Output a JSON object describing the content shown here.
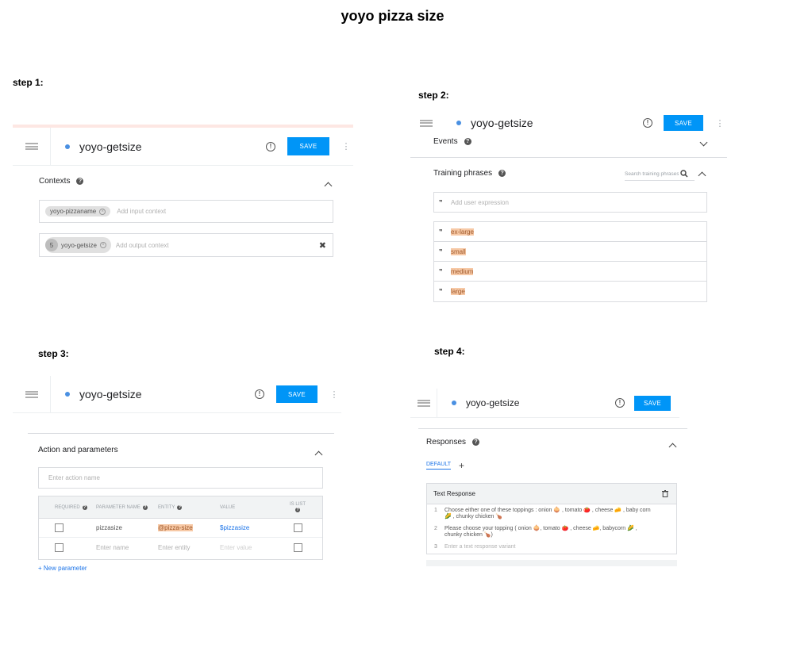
{
  "page_title": "yoyo pizza size",
  "steps": [
    "step 1:",
    "step 2:",
    "step 3:",
    "step 4:"
  ],
  "intent_name": "yoyo-getsize",
  "save_label": "SAVE",
  "step1": {
    "contexts_label": "Contexts",
    "input_chip": "yoyo-pizzaname",
    "input_placeholder": "Add input context",
    "output_lifespan": "5",
    "output_chip": "yoyo-getsize",
    "output_placeholder": "Add output context"
  },
  "step2": {
    "events_label": "Events",
    "training_label": "Training phrases",
    "search_placeholder": "Search training phrases",
    "add_expression_placeholder": "Add user expression",
    "phrases": [
      "ex-large",
      "small",
      "medium",
      "large"
    ]
  },
  "step3": {
    "section_label": "Action and parameters",
    "action_placeholder": "Enter action name",
    "columns": {
      "required": "REQUIRED",
      "param_name": "PARAMETER NAME",
      "entity": "ENTITY",
      "value": "VALUE",
      "is_list": "IS LIST"
    },
    "row1": {
      "name": "pizzasize",
      "entity": "@pizza-size",
      "value": "$pizzasize"
    },
    "row2": {
      "name": "Enter name",
      "entity": "Enter entity",
      "value": "Enter value"
    },
    "new_param": "+ New parameter"
  },
  "step4": {
    "responses_label": "Responses",
    "default_tab": "DEFAULT",
    "add_tab": "+",
    "text_response_label": "Text Response",
    "lines": [
      {
        "n": "1",
        "text": "Choose either one of these toppings : onion 🧅 , tomato 🍅 , cheese 🧀 , baby corn 🌽 , chunky chicken 🍗"
      },
      {
        "n": "2",
        "text": "Please choose your topping ( onion 🧅, tomato 🍅 , cheese 🧀, babycorn 🌽 , chunky chicken 🍗)"
      },
      {
        "n": "3",
        "text": "Enter a text response variant"
      }
    ]
  }
}
